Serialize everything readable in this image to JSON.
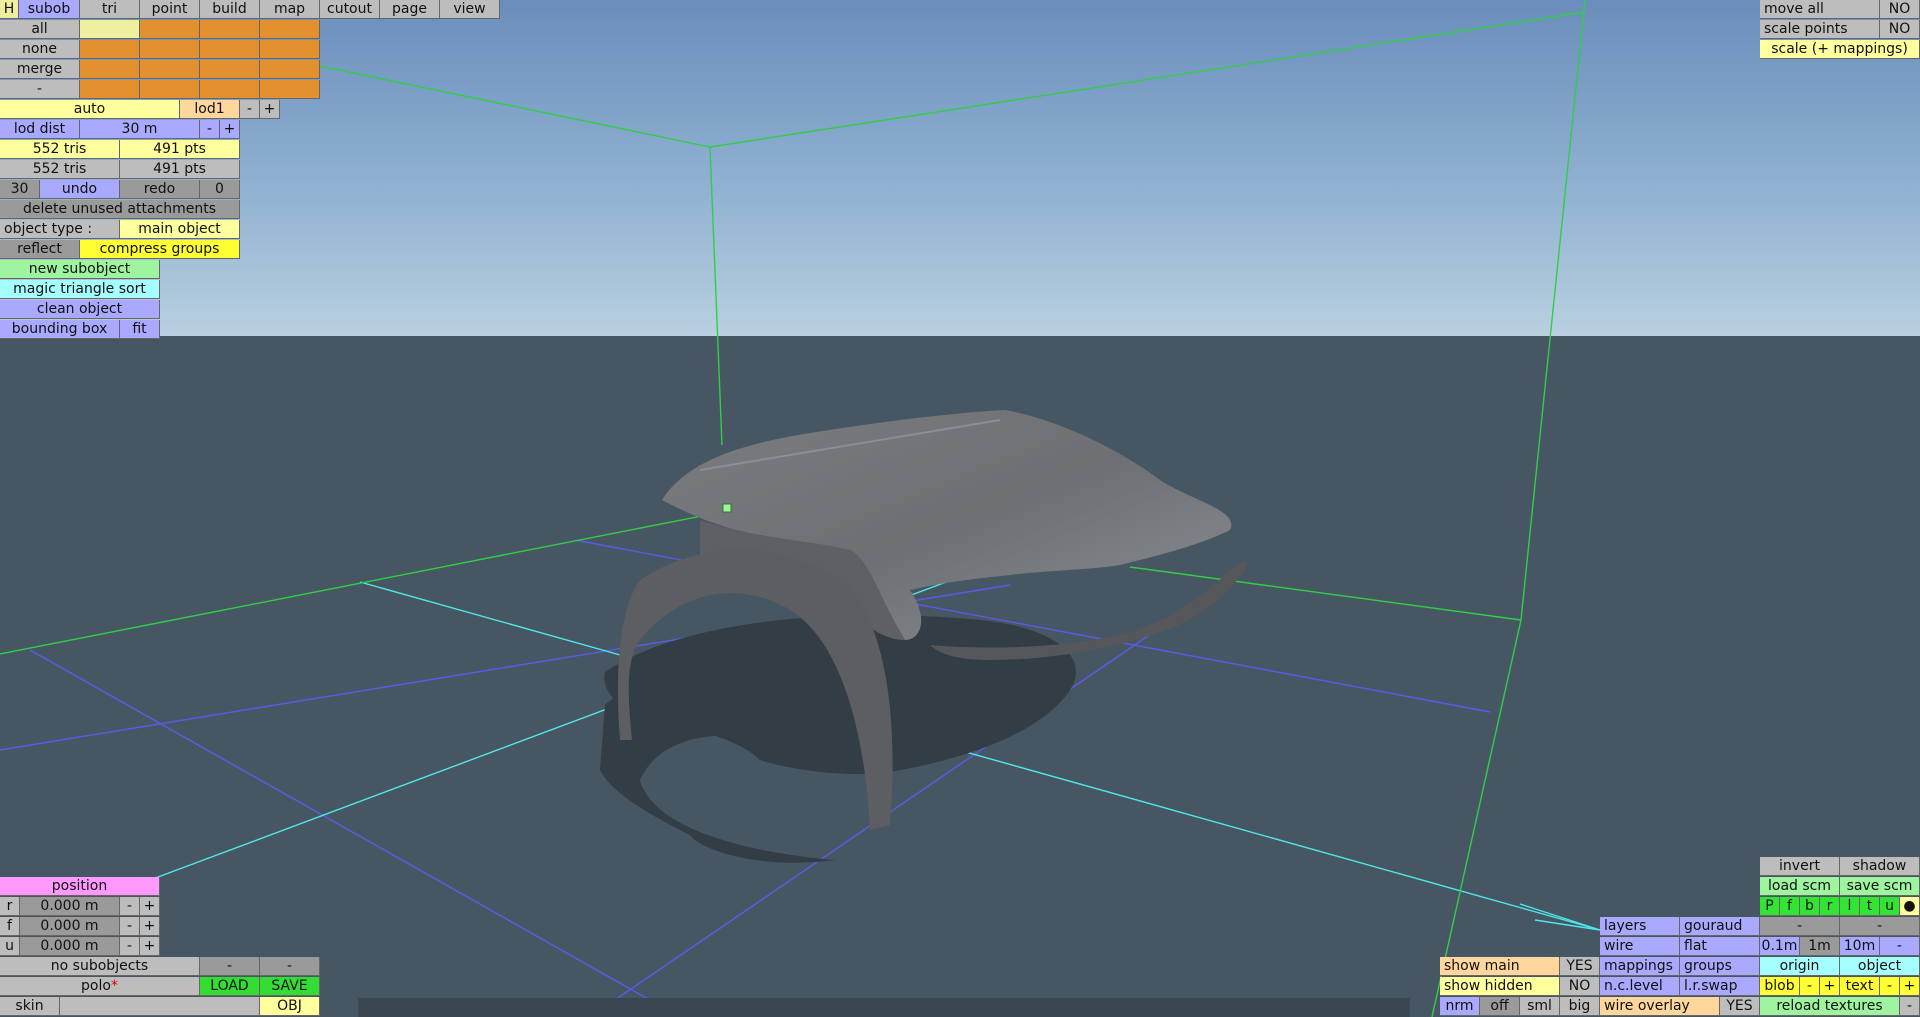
{
  "colors": {
    "sky_top": "#6a8dbb",
    "sky_horizon": "#b7cfe0",
    "ground": "#475663",
    "bbox_lines": "#2fcf45",
    "grid_blue": "#5a5ae8",
    "grid_cyan": "#4fe8e8",
    "model_gray": "#6f7174"
  },
  "menu": {
    "h": "H",
    "tabs": [
      "subob",
      "tri",
      "point",
      "build",
      "map",
      "cutout",
      "page",
      "view"
    ]
  },
  "select": {
    "all": "all",
    "none": "none",
    "merge": "merge",
    "minus": "-"
  },
  "lod": {
    "auto": "auto",
    "lod1": "lod1",
    "minus": "-",
    "plus": "+",
    "lod_dist": "lod dist",
    "dist_value": "30 m",
    "dist_minus": "-",
    "dist_plus": "+"
  },
  "stats": {
    "tris_a": "552 tris",
    "pts_a": "491 pts",
    "tris_b": "552 tris",
    "pts_b": "491 pts"
  },
  "history": {
    "undo_count": "30",
    "undo": "undo",
    "redo": "redo",
    "redo_count": "0"
  },
  "actions": {
    "delete_unused": "delete unused attachments",
    "object_type_label": "object type :",
    "object_type_value": "main object",
    "reflect": "reflect",
    "compress_groups": "compress groups",
    "new_subobject": "new subobject",
    "magic_sort": "magic triangle sort",
    "clean_object": "clean object",
    "bounding_box": "bounding box",
    "fit": "fit"
  },
  "position": {
    "title": "position",
    "rows": [
      {
        "axis": "r",
        "value": "0.000 m",
        "minus": "-",
        "plus": "+"
      },
      {
        "axis": "f",
        "value": "0.000 m",
        "minus": "-",
        "plus": "+"
      },
      {
        "axis": "u",
        "value": "0.000 m",
        "minus": "-",
        "plus": "+"
      }
    ]
  },
  "subobjects": {
    "label": "no subobjects",
    "minus_a": "-",
    "minus_b": "-"
  },
  "file": {
    "name": "polo",
    "modified_mark": "*",
    "load": "LOAD",
    "save": "SAVE",
    "skin": "skin",
    "obj": "OBJ"
  },
  "top_right": {
    "move_all": "move all",
    "move_all_value": "NO",
    "scale_points": "scale points",
    "scale_points_value": "NO",
    "scale_mappings": "scale (+ mappings)"
  },
  "view_panel": {
    "invert": "invert",
    "shadow": "shadow",
    "load_scm": "load scm",
    "save_scm": "save scm",
    "dirs": [
      "P",
      "f",
      "b",
      "r",
      "l",
      "t",
      "u"
    ],
    "dot": "●",
    "layers": "layers",
    "gouraud": "gouraud",
    "minus_a": "-",
    "minus_b": "-",
    "wire": "wire",
    "flat": "flat",
    "grid_01": "0.1m",
    "grid_1": "1m",
    "grid_10": "10m",
    "grid_minus": "-",
    "mappings": "mappings",
    "groups": "groups",
    "origin": "origin",
    "object": "object",
    "nc_level": "n.c.level",
    "lr_swap": "l.r.swap",
    "blob": "blob",
    "blob_minus": "-",
    "blob_plus": "+",
    "text": "text",
    "text_minus": "-",
    "text_plus": "+",
    "show_main": "show main",
    "show_main_value": "YES",
    "show_hidden": "show hidden",
    "show_hidden_value": "NO",
    "nrm": "nrm",
    "off": "off",
    "sml": "sml",
    "big": "big",
    "wire_overlay": "wire overlay",
    "wire_overlay_value": "YES",
    "reload_textures": "reload textures",
    "reload_minus": "-"
  }
}
